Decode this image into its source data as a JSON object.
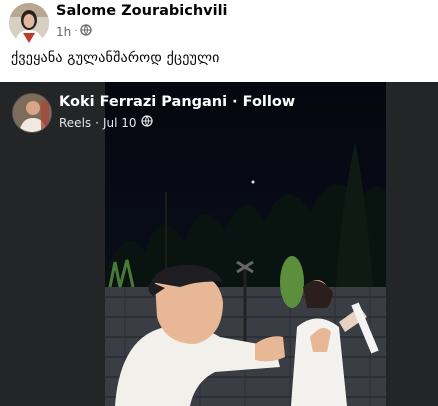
{
  "post": {
    "author_name": "Salome Zourabichvili",
    "time": "1h",
    "separator": "·",
    "privacy_icon": "gear-globe-icon",
    "caption": "ქვეყანა გულანშაროდ ქცეული"
  },
  "reel": {
    "author_name": "Koki Ferrazi Pangani",
    "separator": "·",
    "follow_label": "Follow",
    "type_label": "Reels",
    "date": "Jul 10",
    "privacy_icon": "globe-icon"
  },
  "colors": {
    "dark_background": "#242526",
    "meta_text": "#65676b"
  }
}
